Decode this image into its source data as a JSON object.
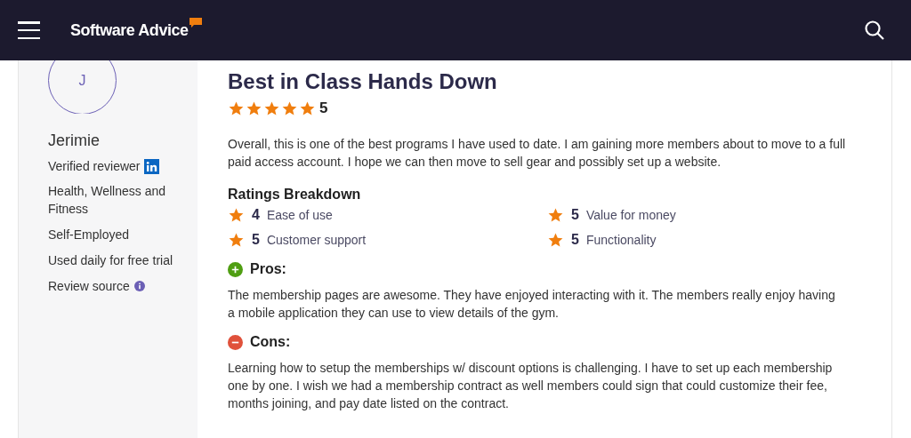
{
  "header": {
    "brand": "Software Advice"
  },
  "reviewer": {
    "initial": "J",
    "name": "Jerimie",
    "verified": "Verified reviewer",
    "industry": "Health, Wellness and Fitness",
    "company_size": "Self-Employed",
    "usage": "Used daily for free trial",
    "source": "Review source"
  },
  "review": {
    "title": "Best in Class Hands Down",
    "stars": 5,
    "score": "5",
    "summary": "Overall, this is one of the best programs I have used to date. I am gaining more members about to move to a full paid access account. I hope we can then move to sell gear and possibly set up a website.",
    "breakdown_title": "Ratings Breakdown",
    "ratings": [
      {
        "score": "4",
        "label": "Ease of use"
      },
      {
        "score": "5",
        "label": "Value for money"
      },
      {
        "score": "5",
        "label": "Customer support"
      },
      {
        "score": "5",
        "label": "Functionality"
      }
    ],
    "sections": [
      {
        "kind": "pros",
        "title": "Pros:",
        "text": "The membership pages are awesome. They have enjoyed interacting with it. The members really enjoy having a mobile application they can use to view details of the gym."
      },
      {
        "kind": "cons",
        "title": "Cons:",
        "text": "Learning how to setup the memberships w/ discount options is challenging. I have to set up each membership one by one. I wish we had a membership contract as well members could sign that could customize their fee, months joining, and pay date listed on the contract."
      }
    ]
  }
}
